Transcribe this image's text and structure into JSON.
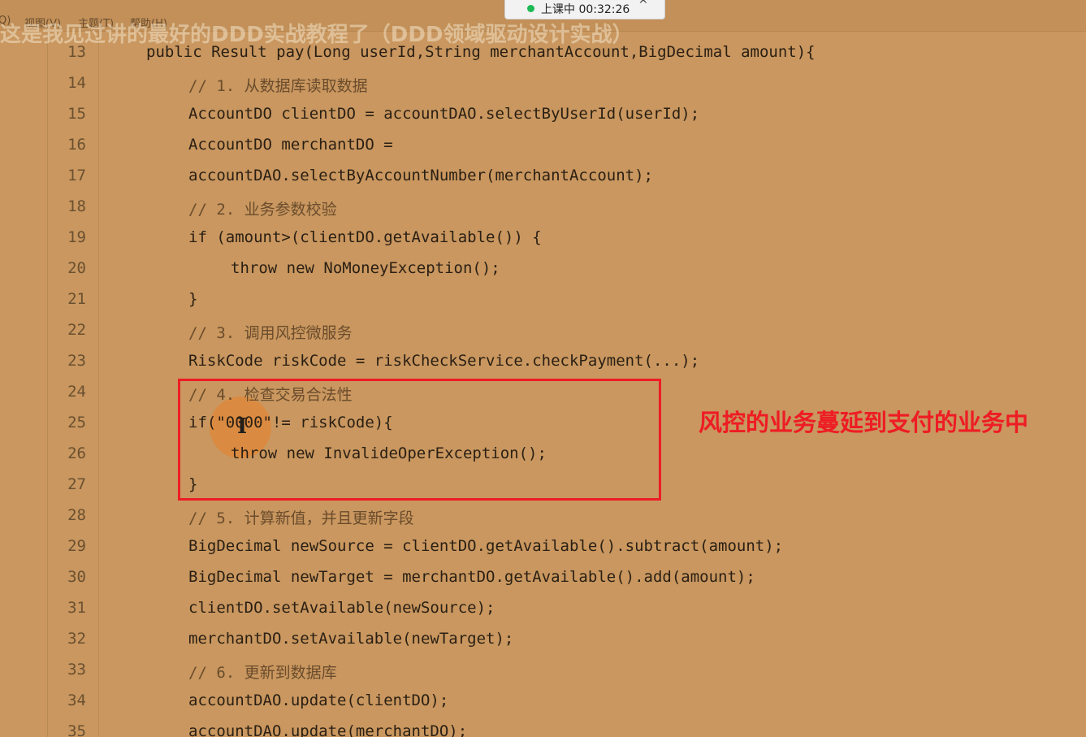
{
  "menu": {
    "items": [
      "Q)",
      "视图(V)",
      "主题(T)",
      "帮助(H)"
    ]
  },
  "course_title": "这是我见过讲的最好的DDD实战教程了（DDD领域驱动设计实战）",
  "status": {
    "text": "上课中 00:32:26",
    "indicator_color": "#1db954",
    "chevron": "^"
  },
  "editor": {
    "lines": [
      {
        "num": "13",
        "text": "public Result pay(Long userId,String merchantAccount,BigDecimal amount){",
        "indent": 0,
        "comment": false
      },
      {
        "num": "14",
        "text": "// 1. 从数据库读取数据",
        "indent": 1,
        "comment": true
      },
      {
        "num": "15",
        "text": "AccountDO clientDO = accountDAO.selectByUserId(userId);",
        "indent": 1,
        "comment": false
      },
      {
        "num": "16",
        "text": "AccountDO merchantDO =",
        "indent": 1,
        "comment": false
      },
      {
        "num": "17",
        "text": "accountDAO.selectByAccountNumber(merchantAccount);",
        "indent": 1,
        "comment": false
      },
      {
        "num": "18",
        "text": "// 2. 业务参数校验",
        "indent": 1,
        "comment": true
      },
      {
        "num": "19",
        "text": "if (amount>(clientDO.getAvailable()) {",
        "indent": 1,
        "comment": false
      },
      {
        "num": "20",
        "text": "throw new NoMoneyException();",
        "indent": 2,
        "comment": false
      },
      {
        "num": "21",
        "text": "}",
        "indent": 1,
        "comment": false
      },
      {
        "num": "22",
        "text": "// 3. 调用风控微服务",
        "indent": 1,
        "comment": true
      },
      {
        "num": "23",
        "text": "RiskCode riskCode = riskCheckService.checkPayment(...);",
        "indent": 1,
        "comment": false
      },
      {
        "num": "24",
        "text": "// 4. 检查交易合法性",
        "indent": 1,
        "comment": true
      },
      {
        "num": "25",
        "text": "if(\"0000\"!= riskCode){",
        "indent": 1,
        "comment": false
      },
      {
        "num": "26",
        "text": "throw new InvalideOperException();",
        "indent": 2,
        "comment": false
      },
      {
        "num": "27",
        "text": "}",
        "indent": 1,
        "comment": false
      },
      {
        "num": "28",
        "text": "// 5. 计算新值，并且更新字段",
        "indent": 1,
        "comment": true
      },
      {
        "num": "29",
        "text": "BigDecimal newSource = clientDO.getAvailable().subtract(amount);",
        "indent": 1,
        "comment": false
      },
      {
        "num": "30",
        "text": "BigDecimal newTarget = merchantDO.getAvailable().add(amount);",
        "indent": 1,
        "comment": false
      },
      {
        "num": "31",
        "text": "clientDO.setAvailable(newSource);",
        "indent": 1,
        "comment": false
      },
      {
        "num": "32",
        "text": "merchantDO.setAvailable(newTarget);",
        "indent": 1,
        "comment": false
      },
      {
        "num": "33",
        "text": "// 6. 更新到数据库",
        "indent": 1,
        "comment": true
      },
      {
        "num": "34",
        "text": "accountDAO.update(clientDO);",
        "indent": 1,
        "comment": false
      },
      {
        "num": "35",
        "text": "accountDAO.update(merchantDO);",
        "indent": 1,
        "comment": false
      }
    ]
  },
  "annotation": {
    "text": "风控的业务蔓延到支付的业务中",
    "color": "#ee1c24"
  },
  "colors": {
    "background": "#c9975f",
    "code_text": "#2a1f14",
    "comment_text": "#6b4c2c",
    "line_number": "#6b5030",
    "highlight_box": "#ee1c24",
    "cursor_halo": "#e88228"
  },
  "icons": {
    "status_indicator": "green-dot-icon",
    "collapse": "chevron-up-icon",
    "cursor": "text-cursor-icon"
  }
}
